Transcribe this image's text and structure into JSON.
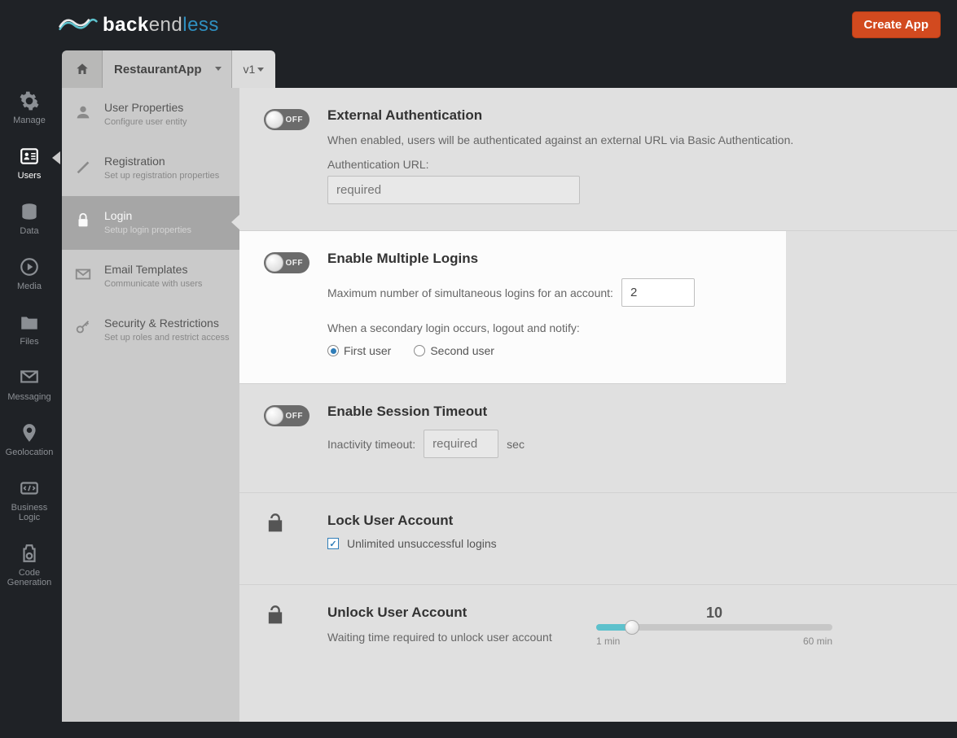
{
  "brand": {
    "part1": "back",
    "part2": "end",
    "part3": "less"
  },
  "header": {
    "create_app": "Create App"
  },
  "tabs": {
    "app_name": "RestaurantApp",
    "version": "v1"
  },
  "leftnav": [
    {
      "label": "Manage",
      "name": "manage",
      "active": false
    },
    {
      "label": "Users",
      "name": "users",
      "active": true
    },
    {
      "label": "Data",
      "name": "data",
      "active": false
    },
    {
      "label": "Media",
      "name": "media",
      "active": false
    },
    {
      "label": "Files",
      "name": "files",
      "active": false
    },
    {
      "label": "Messaging",
      "name": "messaging",
      "active": false
    },
    {
      "label": "Geolocation",
      "name": "geolocation",
      "active": false
    },
    {
      "label": "Business Logic",
      "name": "business-logic",
      "active": false
    },
    {
      "label": "Code Generation",
      "name": "code-generation",
      "active": false
    }
  ],
  "sidebar": [
    {
      "title": "User Properties",
      "desc": "Configure user entity",
      "name": "user-properties"
    },
    {
      "title": "Registration",
      "desc": "Set up registration properties",
      "name": "registration"
    },
    {
      "title": "Login",
      "desc": "Setup login properties",
      "name": "login",
      "active": true
    },
    {
      "title": "Email Templates",
      "desc": "Communicate with users",
      "name": "email-templates"
    },
    {
      "title": "Security & Restrictions",
      "desc": "Set up roles and restrict access",
      "name": "security"
    }
  ],
  "sections": {
    "ext_auth": {
      "title": "External Authentication",
      "desc": "When enabled, users will be authenticated against an external URL via Basic Authentication.",
      "url_label": "Authentication URL:",
      "url_placeholder": "required",
      "toggle": "OFF"
    },
    "multi_login": {
      "title": "Enable Multiple Logins",
      "max_label": "Maximum number of simultaneous logins for an account:",
      "max_value": "2",
      "secondary_label": "When a secondary login occurs, logout and notify:",
      "opt1": "First user",
      "opt2": "Second user",
      "selected": "first",
      "toggle": "OFF"
    },
    "session_timeout": {
      "title": "Enable Session Timeout",
      "label": "Inactivity timeout:",
      "placeholder": "required",
      "unit": "sec",
      "toggle": "OFF"
    },
    "lock": {
      "title": "Lock User Account",
      "checkbox_label": "Unlimited unsuccessful logins",
      "checked": true
    },
    "unlock": {
      "title": "Unlock User Account",
      "desc": "Waiting time required to unlock user account",
      "value": "10",
      "min_label": "1 min",
      "max_label": "60 min",
      "percent": 15
    }
  }
}
